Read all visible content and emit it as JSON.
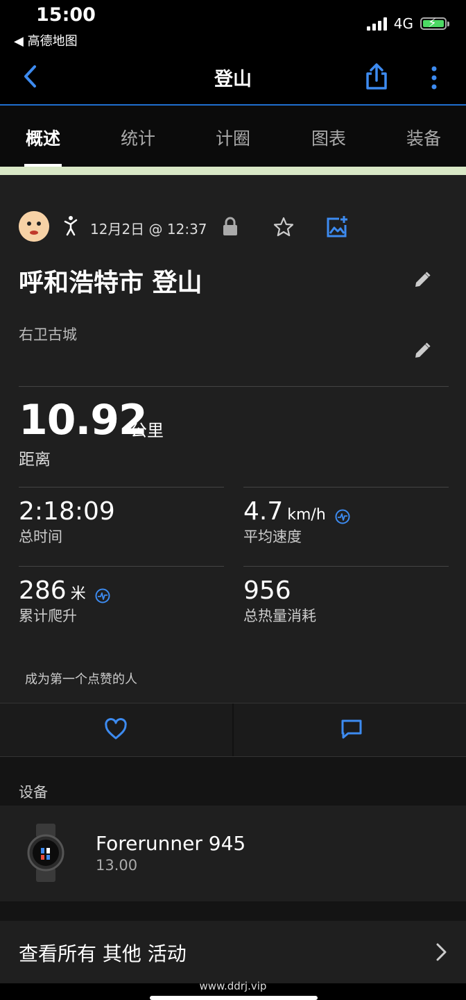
{
  "status": {
    "time": "15:00",
    "back_app": "◀ 高德地图",
    "network": "4G"
  },
  "header": {
    "title": "登山"
  },
  "tabs": [
    "概述",
    "统计",
    "计圈",
    "图表",
    "装备"
  ],
  "activity": {
    "date": "12月2日 @ 12:37",
    "title": "呼和浩特市 登山",
    "location": "右卫古城",
    "distance": {
      "value": "10.92",
      "unit": "公里",
      "label": "距离"
    },
    "stats": [
      {
        "value": "2:18:09",
        "unit": "",
        "label": "总时间"
      },
      {
        "value": "4.7",
        "unit": "km/h",
        "label": "平均速度"
      },
      {
        "value": "286",
        "unit": "米",
        "label": "累计爬升"
      },
      {
        "value": "956",
        "unit": "",
        "label": "总热量消耗"
      }
    ],
    "likes_text": "成为第一个点赞的人"
  },
  "devices": {
    "section_label": "设备",
    "name": "Forerunner 945",
    "version": "13.00"
  },
  "more_activities": "查看所有 其他 活动",
  "watermark": "www.ddrj.vip",
  "colors": {
    "accent": "#3d8bf0",
    "background": "#1f1f1f"
  }
}
